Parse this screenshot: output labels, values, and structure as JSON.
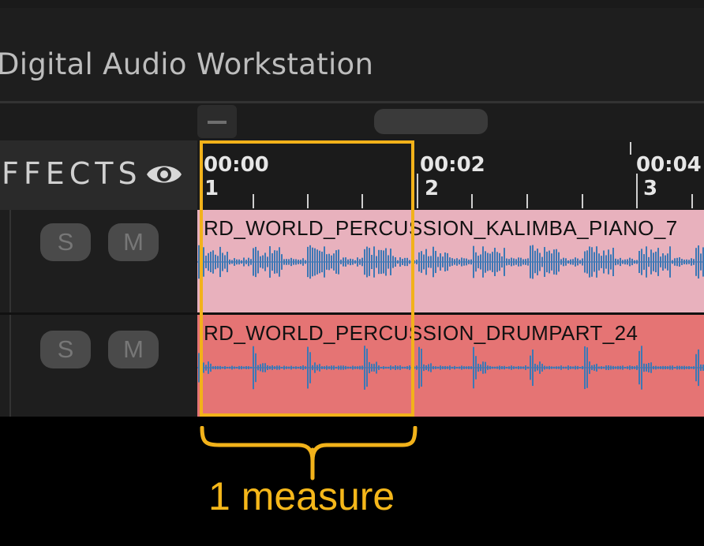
{
  "app": {
    "title": "Digital Audio Workstation"
  },
  "effects_header": {
    "label": "FFECTS",
    "icon": "eye-icon"
  },
  "ruler": {
    "markers": [
      {
        "time": "00:00",
        "bar": "1"
      },
      {
        "time": "00:02",
        "bar": "2"
      },
      {
        "time": "00:04",
        "bar": "3"
      }
    ]
  },
  "tracks": [
    {
      "solo": "S",
      "mute": "M",
      "clip_name": "RD_WORLD_PERCUSSION_KALIMBA_PIANO_7",
      "clip_color": "#e8b1bd",
      "wave_color": "#3d78b5"
    },
    {
      "solo": "S",
      "mute": "M",
      "clip_name": "RD_WORLD_PERCUSSION_DRUMPART_24",
      "clip_color": "#e57474",
      "wave_color": "#3d78b5"
    }
  ],
  "annotation": {
    "label": "1 measure",
    "color": "#f2b21a"
  }
}
